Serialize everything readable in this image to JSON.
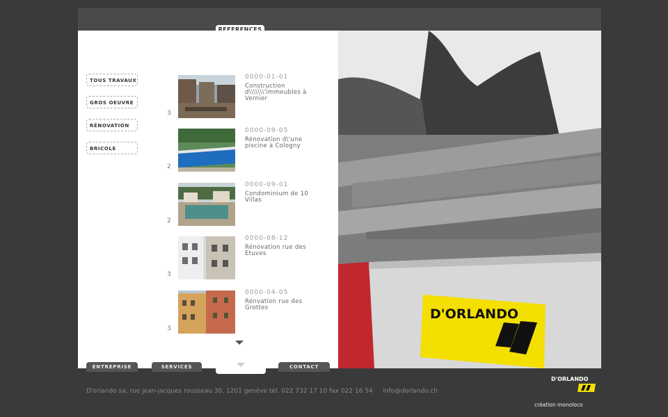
{
  "header": {
    "tab_label": "REFERENCES"
  },
  "categories": [
    {
      "label": "TOUS TRAVAUX"
    },
    {
      "label": "GROS OEUVRE"
    },
    {
      "label": "RÉNOVATION"
    },
    {
      "label": "BRICOLE"
    }
  ],
  "references": [
    {
      "count": "3",
      "date": "0000-01-01",
      "title": "Construction d\\\\\\\\\\\\\\'immeubles à Vernier"
    },
    {
      "count": "2",
      "date": "0000-09-05",
      "title": "Rénovation d\\'une piscine à Cologny"
    },
    {
      "count": "2",
      "date": "0000-09-01",
      "title": "Condominium de 10 Villas"
    },
    {
      "count": "3",
      "date": "0000-08-12",
      "title": "Rénovation rue des Etuves"
    },
    {
      "count": "3",
      "date": "0000-04-05",
      "title": "Rénvation rue des Grottes"
    }
  ],
  "nav": {
    "entreprise": "ENTREPRISE",
    "services": "SERVICES",
    "contact": "CONTACT"
  },
  "footer": {
    "address": "D'orlando sa, rue jean-jacques rousseau 30, 1201 genève tél. 022 732 17 10 fax 022 16 54",
    "email": "info@dorlando.ch",
    "logo_text": "D'ORLANDO",
    "credit": "création monoloco"
  },
  "photo": {
    "sign_text": "D'ORLANDO"
  },
  "colors": {
    "accent_yellow": "#f3df00",
    "frame_dark": "#1e1e1e",
    "bar_gray": "#4a4a4a",
    "barrier_red": "#c0282d"
  }
}
